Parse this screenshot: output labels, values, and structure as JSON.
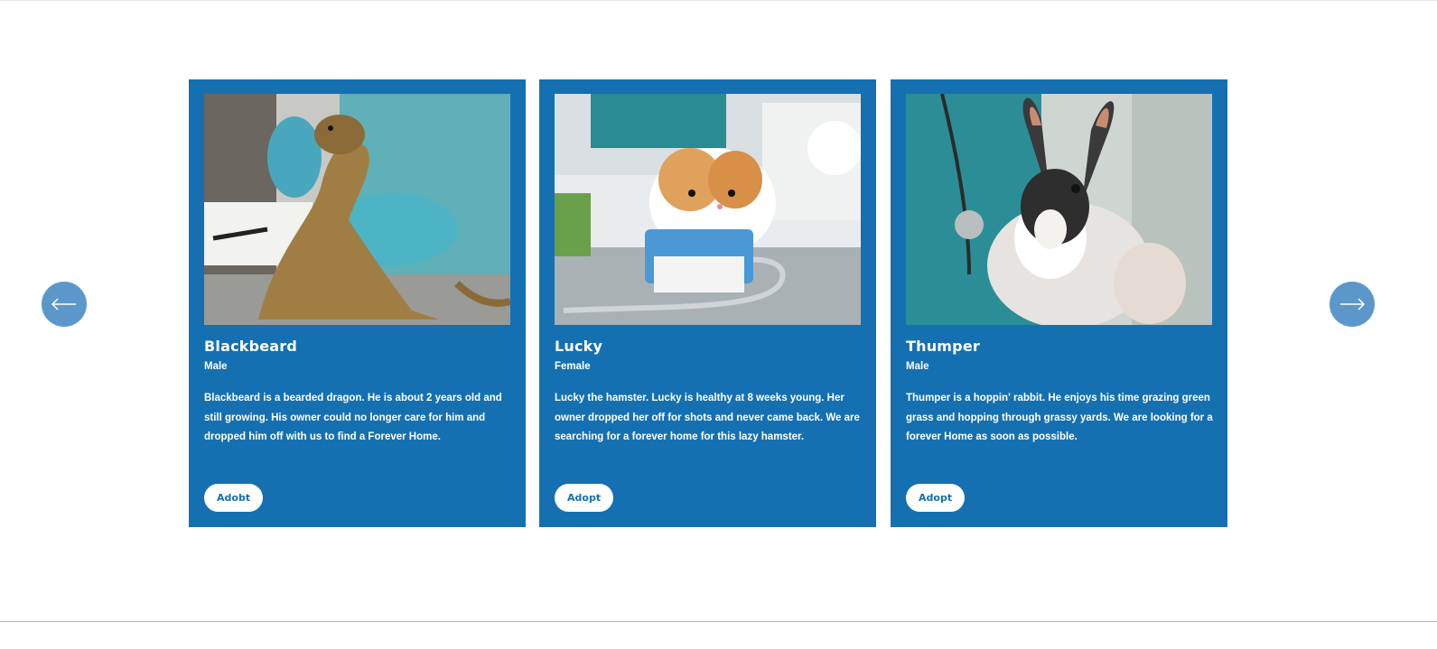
{
  "navigation": {
    "prev_icon": "arrow-left-icon",
    "next_icon": "arrow-right-icon",
    "arrow_color": "#5b98c9"
  },
  "theme": {
    "card_background": "#1570b2",
    "button_text": "#1570b2"
  },
  "pets": [
    {
      "name": "Blackbeard",
      "sex": "Male",
      "description": "Blackbeard is a bearded dragon. He is about 2 years old and still growing. His owner could no longer care for him and dropped him off with us to find a Forever Home.",
      "button_label": "Adobt",
      "image": "bearded-dragon-photo"
    },
    {
      "name": "Lucky",
      "sex": "Female",
      "description": "Lucky the hamster. Lucky is healthy at 8 weeks young. Her owner dropped her off for shots and never came back. We are searching for a forever home for this lazy hamster.",
      "button_label": "Adopt",
      "image": "hamster-photo"
    },
    {
      "name": "Thumper",
      "sex": "Male",
      "description": "Thumper is a hoppin' rabbit. He enjoys his time grazing green grass and hopping through grassy yards. We are looking for a forever Home as soon as possible.",
      "button_label": "Adopt",
      "image": "rabbit-photo"
    }
  ]
}
